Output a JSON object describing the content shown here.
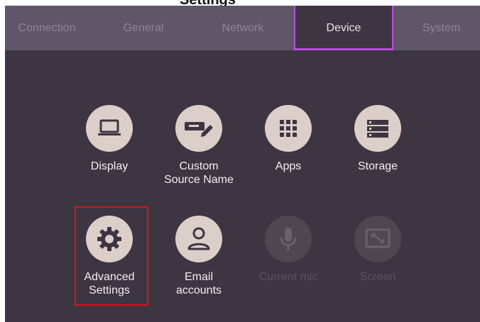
{
  "page": {
    "title_fragment": "Settings"
  },
  "tabs": [
    {
      "label": "Connection",
      "active": false
    },
    {
      "label": "General",
      "active": false
    },
    {
      "label": "Network",
      "active": false
    },
    {
      "label": "Device",
      "active": true
    },
    {
      "label": "System",
      "active": false
    }
  ],
  "tiles": [
    {
      "label": "Display",
      "icon": "laptop-icon",
      "enabled": true
    },
    {
      "label": "Custom\nSource Name",
      "icon": "rename-tag-icon",
      "enabled": true
    },
    {
      "label": "Apps",
      "icon": "apps-grid-icon",
      "enabled": true
    },
    {
      "label": "Storage",
      "icon": "storage-icon",
      "enabled": true
    },
    {
      "label": "Advanced\nSettings",
      "icon": "gear-icon",
      "enabled": true,
      "highlighted": true
    },
    {
      "label": "Email\naccounts",
      "icon": "person-icon",
      "enabled": true
    },
    {
      "label": "Current mic",
      "icon": "microphone-icon",
      "enabled": false
    },
    {
      "label": "Screen",
      "icon": "screen-icon",
      "enabled": false
    }
  ],
  "colors": {
    "panel_bg": "#3d3541",
    "tabbar_bg": "#5f566a",
    "active_tab_border": "#b84fe0",
    "icon_circle": "#dccfc9",
    "icon_glyph": "#3d3541",
    "highlight_border": "#e0101a"
  }
}
